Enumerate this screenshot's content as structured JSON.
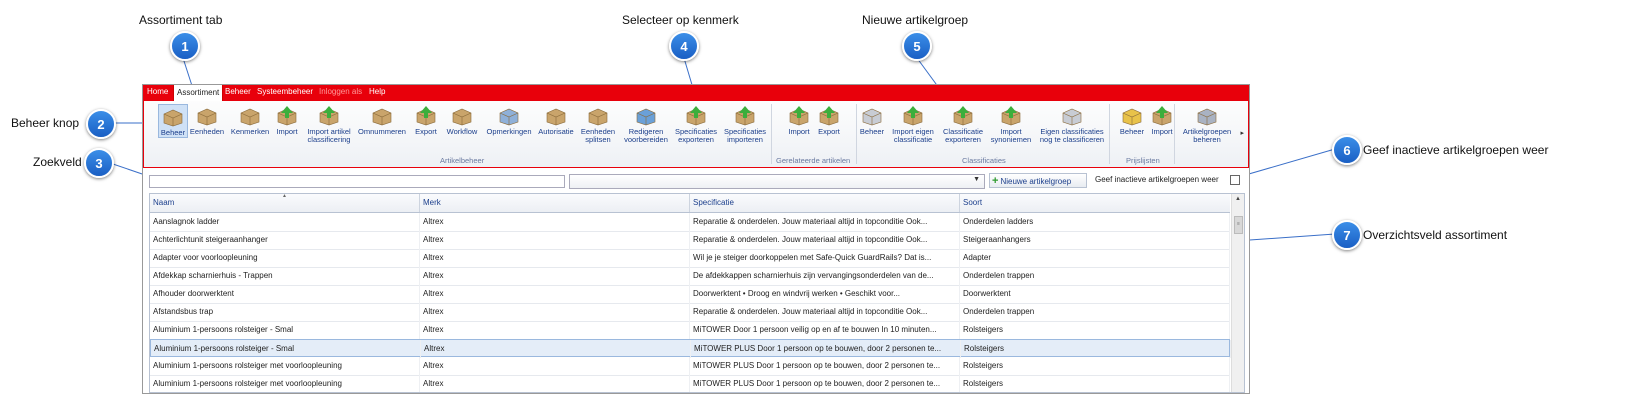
{
  "callouts": [
    {
      "num": "1",
      "label": "Assortiment tab"
    },
    {
      "num": "2",
      "label": "Beheer knop"
    },
    {
      "num": "3",
      "label": "Zoekveld"
    },
    {
      "num": "4",
      "label": "Selecteer op kenmerk"
    },
    {
      "num": "5",
      "label": "Nieuwe artikelgroep"
    },
    {
      "num": "6",
      "label": "Geef inactieve artikelgroepen weer"
    },
    {
      "num": "7",
      "label": "Overzichtsveld assortiment"
    }
  ],
  "menu": [
    "Home",
    "Assortiment",
    "Beheer",
    "Systeembeheer",
    "Inloggen als",
    "Help"
  ],
  "ribbon": {
    "buttons": [
      {
        "label": "Beheer",
        "icon": "box-icon",
        "selected": true
      },
      {
        "label": "Eenheden",
        "icon": "boxes-icon"
      },
      {
        "label": "Kenmerken",
        "icon": "box-tag-icon"
      },
      {
        "label": "Import",
        "icon": "box-import-icon"
      },
      {
        "label": "Import artikel classificering",
        "icon": "document-import-icon"
      },
      {
        "label": "Omnummeren",
        "icon": "box-renumber-icon"
      },
      {
        "label": "Export",
        "icon": "box-export-icon"
      },
      {
        "label": "Workflow",
        "icon": "workflow-icon"
      },
      {
        "label": "Opmerkingen",
        "icon": "comment-icon"
      },
      {
        "label": "Autorisatie",
        "icon": "box-check-icon"
      },
      {
        "label": "Eenheden splitsen",
        "icon": "boxes-split-icon"
      },
      {
        "label": "Redigeren voorbereiden",
        "icon": "edit-prepare-icon"
      },
      {
        "label": "Specificaties exporteren",
        "icon": "spec-export-icon"
      },
      {
        "label": "Specificaties importeren",
        "icon": "spec-import-icon"
      },
      {
        "label": "Import",
        "icon": "box-import-icon"
      },
      {
        "label": "Export",
        "icon": "box-export-icon"
      },
      {
        "label": "Beheer",
        "icon": "folder-icon"
      },
      {
        "label": "Import eigen classificatie",
        "icon": "folder-import-icon"
      },
      {
        "label": "Classificatie exporteren",
        "icon": "folder-export-icon"
      },
      {
        "label": "Import synoniemen",
        "icon": "synonym-import-icon"
      },
      {
        "label": "Eigen classificaties nog te classificeren",
        "icon": "folder-icon"
      },
      {
        "label": "Beheer",
        "icon": "price-icon"
      },
      {
        "label": "Import",
        "icon": "price-import-icon"
      },
      {
        "label": "Artikelgroepen beheren",
        "icon": "group-manage-icon"
      }
    ],
    "groups": [
      "Artikelbeheer",
      "Gerelateerde artikelen",
      "Classificaties",
      "Prijslijsten"
    ]
  },
  "toolbar": {
    "search_value": "",
    "select_value": "",
    "new_group_label": "Nieuwe artikelgroep",
    "inactive_label": "Geef inactieve artikelgroepen weer",
    "inactive_checked": false
  },
  "grid": {
    "columns": [
      "Naam",
      "Merk",
      "Specificatie",
      "Soort"
    ],
    "rows": [
      [
        "Aanslagnok ladder",
        "Altrex",
        "Reparatie & onderdelen. Jouw materiaal altijd in topconditie    Ook...",
        "Onderdelen ladders"
      ],
      [
        "Achterlichtunit steigeraanhanger",
        "Altrex",
        "Reparatie & onderdelen. Jouw materiaal altijd in topconditie    Ook...",
        "Steigeraanhangers"
      ],
      [
        "Adapter voor voorloopleuning",
        "Altrex",
        "Wil je je steiger doorkoppelen met Safe-Quick GuardRails? Dat is...",
        "Adapter"
      ],
      [
        "Afdekkap scharnierhuis - Trappen",
        "Altrex",
        "De afdekkappen scharnierhuis zijn vervangingsonderdelen van de...",
        "Onderdelen trappen"
      ],
      [
        "Afhouder doorwerktent",
        "Altrex",
        "Doorwerktent • Droog en windvrij werken • Geschikt voor...",
        "Doorwerktent"
      ],
      [
        "Afstandsbus trap",
        "Altrex",
        "Reparatie & onderdelen. Jouw materiaal altijd in topconditie    Ook...",
        "Onderdelen trappen"
      ],
      [
        "Aluminium 1-persoons rolsteiger - Smal",
        "Altrex",
        "MiTOWER Door 1 persoon veilig op en af te bouwen In 10 minuten...",
        "Rolsteigers"
      ],
      [
        "Aluminium 1-persoons rolsteiger - Smal",
        "Altrex",
        "MiTOWER PLUS Door 1 persoon op te bouwen, door 2 personen te...",
        "Rolsteigers"
      ],
      [
        "Aluminium 1-persoons rolsteiger met voorloopleuning",
        "Altrex",
        "MiTOWER PLUS Door 1 persoon op te bouwen, door 2 personen te...",
        "Rolsteigers"
      ],
      [
        "Aluminium 1-persoons rolsteiger met voorloopleuning",
        "Altrex",
        "MiTOWER PLUS Door 1 persoon op te bouwen, door 2 personen te...",
        "Rolsteigers"
      ]
    ],
    "selected_row": 7
  }
}
